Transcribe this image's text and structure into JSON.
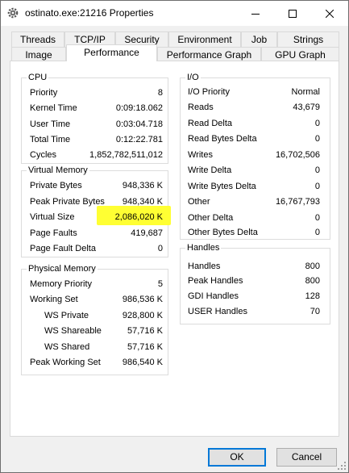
{
  "window": {
    "title": "ostinato.exe:21216 Properties",
    "icon": "gear-icon"
  },
  "tabs": {
    "row1": [
      "Threads",
      "TCP/IP",
      "Security",
      "Environment",
      "Job",
      "Strings"
    ],
    "row2": [
      "Image",
      "Performance",
      "Performance Graph",
      "GPU Graph"
    ],
    "active": "Performance"
  },
  "cpu": {
    "title": "CPU",
    "rows": [
      {
        "label": "Priority",
        "value": "8"
      },
      {
        "label": "Kernel Time",
        "value": "0:09:18.062"
      },
      {
        "label": "User Time",
        "value": "0:03:04.718"
      },
      {
        "label": "Total Time",
        "value": "0:12:22.781"
      },
      {
        "label": "Cycles",
        "value": "1,852,782,511,012"
      }
    ]
  },
  "virtual_memory": {
    "title": "Virtual Memory",
    "rows": [
      {
        "label": "Private Bytes",
        "value": "948,336 K"
      },
      {
        "label": "Peak Private Bytes",
        "value": "948,340 K"
      },
      {
        "label": "Virtual Size",
        "value": "2,086,020 K"
      },
      {
        "label": "Page Faults",
        "value": "419,687"
      },
      {
        "label": "Page Fault Delta",
        "value": "0"
      }
    ],
    "highlight_color": "#ffff33"
  },
  "physical_memory": {
    "title": "Physical Memory",
    "rows": [
      {
        "label": "Memory Priority",
        "value": "5"
      },
      {
        "label": "Working Set",
        "value": "986,536 K"
      },
      {
        "label": "WS Private",
        "value": "928,800 K"
      },
      {
        "label": "WS Shareable",
        "value": "57,716 K"
      },
      {
        "label": "WS Shared",
        "value": "57,716 K"
      },
      {
        "label": "Peak Working Set",
        "value": "986,540 K"
      }
    ]
  },
  "io": {
    "title": "I/O",
    "rows": [
      {
        "label": "I/O Priority",
        "value": "Normal"
      },
      {
        "label": "Reads",
        "value": "43,679"
      },
      {
        "label": "Read Delta",
        "value": "0"
      },
      {
        "label": "Read Bytes Delta",
        "value": "0"
      },
      {
        "label": "Writes",
        "value": "16,702,506"
      },
      {
        "label": "Write Delta",
        "value": "0"
      },
      {
        "label": "Write Bytes Delta",
        "value": "0"
      },
      {
        "label": "Other",
        "value": "16,767,793"
      },
      {
        "label": "Other Delta",
        "value": "0"
      },
      {
        "label": "Other Bytes Delta",
        "value": "0"
      }
    ]
  },
  "handles": {
    "title": "Handles",
    "rows": [
      {
        "label": "Handles",
        "value": "800"
      },
      {
        "label": "Peak Handles",
        "value": "800"
      },
      {
        "label": "GDI Handles",
        "value": "128"
      },
      {
        "label": "USER Handles",
        "value": "70"
      }
    ]
  },
  "buttons": {
    "ok": "OK",
    "cancel": "Cancel"
  }
}
